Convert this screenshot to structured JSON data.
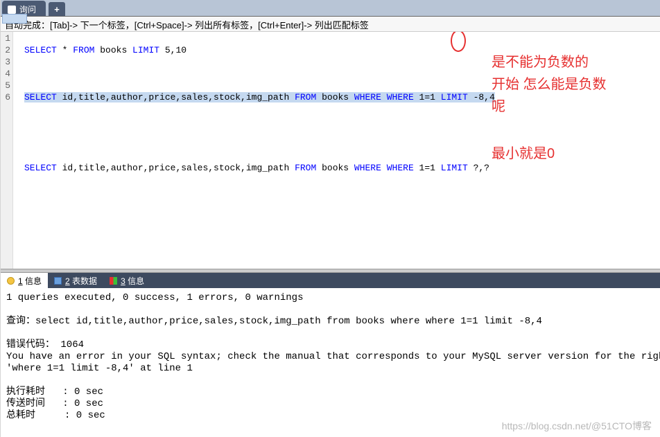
{
  "tab": {
    "label": "询问"
  },
  "hint": "自动完成：[Tab]-> 下一个标签，[Ctrl+Space]-> 列出所有标签，[Ctrl+Enter]-> 列出匹配标签",
  "editor": {
    "lines": [
      "1",
      "2",
      "3",
      "4",
      "5",
      "6"
    ],
    "line1": {
      "kw1": "SELECT",
      "body1": " * ",
      "kw2": "FROM",
      "body2": " books ",
      "kw3": "LIMIT",
      "body3": " 5,10"
    },
    "line3": {
      "kw1": "SELECT",
      "body1": " id,title,author,price,sales,stock,img_path ",
      "kw2": "FROM",
      "body2": " books ",
      "kw3": "WHERE",
      "body3": " ",
      "kw4": "WHERE",
      "body4": " 1=1 ",
      "kw5": "LIMIT",
      "body5": " -8,4"
    },
    "line6": {
      "kw1": "SELECT",
      "body1": " id,title,author,price,sales,stock,img_path ",
      "kw2": "FROM",
      "body2": " books ",
      "kw3": "WHERE",
      "body3": " ",
      "kw4": "WHERE",
      "body4": " 1=1 ",
      "kw5": "LIMIT",
      "body5": " ?,?"
    }
  },
  "annotation": {
    "block1": "是不能为负数的\n开始 怎么能是负数\n呢",
    "block2": "最小就是0"
  },
  "resultTabs": {
    "t1": {
      "num": "1",
      "label": " 信息"
    },
    "t2": {
      "num": "2",
      "label": " 表数据"
    },
    "t3": {
      "num": "3",
      "label": " 信息"
    }
  },
  "output": {
    "summary": "1 queries executed, 0 success, 1 errors, 0 warnings",
    "query_label": "查询：",
    "query": "select id,title,author,price,sales,stock,img_path from books where where 1=1 limit -8,4",
    "errcode_label": "错误代码：",
    "errcode": " 1064",
    "errmsg": "You have an error in your SQL syntax; check the manual that corresponds to your MySQL server version for the righ",
    "errmsg2": "'where 1=1 limit -8,4' at line 1",
    "exec_label": "执行耗时",
    "exec_val": "   : 0 sec",
    "trans_label": "传送时间",
    "trans_val": "   : 0 sec",
    "total_label": "总耗时",
    "total_val": "     : 0 sec"
  },
  "watermark": "https://blog.csdn.net/@51CTO博客"
}
